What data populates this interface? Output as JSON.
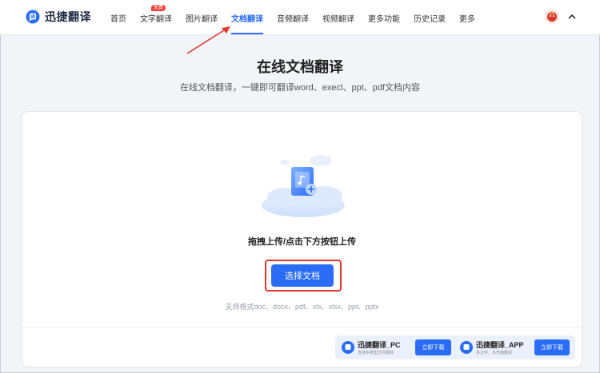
{
  "brand": {
    "name": "迅捷翻译",
    "accent": "#2a6cf6"
  },
  "nav": {
    "items": [
      {
        "label": "首页"
      },
      {
        "label": "文字翻译",
        "badge": "免费"
      },
      {
        "label": "图片翻译"
      },
      {
        "label": "文档翻译",
        "active": true
      },
      {
        "label": "音频翻译"
      },
      {
        "label": "视频翻译"
      },
      {
        "label": "更多功能"
      },
      {
        "label": "历史记录"
      },
      {
        "label": "更多"
      }
    ]
  },
  "hero": {
    "title": "在线文档翻译",
    "subtitle": "在线文档翻译，一键即可翻译word、execl、ppt、pdf文档内容"
  },
  "upload": {
    "drop_text": "拖拽上传/点击下方按钮上传",
    "button_label": "选择文档",
    "formats": "支持格式doc、docx、pdf、xls、xlsx、ppt、pptx"
  },
  "promos": [
    {
      "name": "迅捷翻译_PC",
      "desc": "支持多类型文件翻译",
      "button": "立即下载"
    },
    {
      "name": "迅捷翻译_APP",
      "desc": "多文件、多界面翻译",
      "button": "立即下载"
    }
  ],
  "colors": {
    "highlight": "#e0392f",
    "background": "#f3f4f8"
  }
}
